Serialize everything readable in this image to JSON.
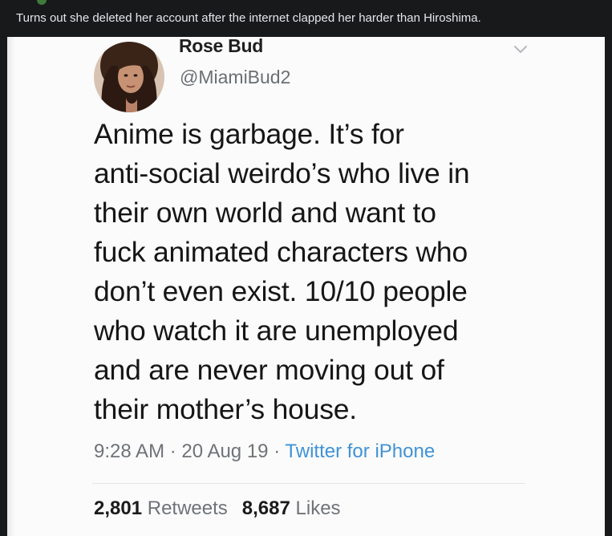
{
  "post": {
    "caption": "Turns out she deleted her account after the internet clapped her harder than Hiroshima."
  },
  "tweet": {
    "display_name": "Rose Bud",
    "handle": "@MiamiBud2",
    "text_lines": [
      "Anime is garbage. It’s for",
      "anti-social weirdo’s who live in",
      "their own world and want to",
      "fuck animated characters who",
      "don’t even exist. 10/10 people",
      "who watch it are unemployed",
      "and are never moving out of",
      "their mother’s house."
    ],
    "time": "9:28 AM",
    "separator": "·",
    "date": "20 Aug 19",
    "source": "Twitter for iPhone",
    "retweets_count": "2,801",
    "retweets_label": "Retweets",
    "likes_count": "8,687",
    "likes_label": "Likes"
  },
  "icons": {
    "avatar": "profile-photo",
    "menu": "chevron-down-icon"
  },
  "colors": {
    "page_background": "#18191a",
    "caption_text": "#e4e6eb",
    "tweet_text": "#161616",
    "muted_text": "#6f7378",
    "link_blue": "#3f93d6"
  }
}
